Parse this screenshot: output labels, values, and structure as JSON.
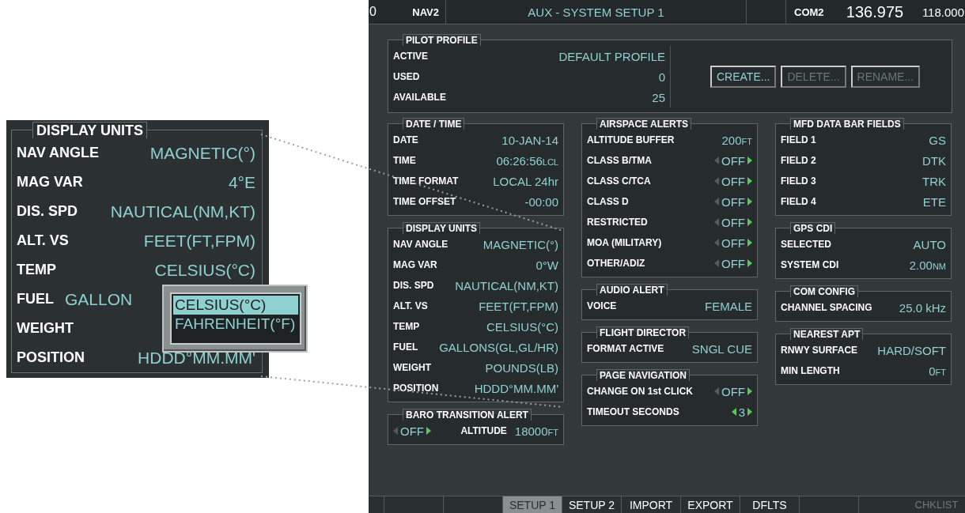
{
  "inset": {
    "title": "DISPLAY UNITS",
    "rows": [
      {
        "label": "NAV ANGLE",
        "value": "MAGNETIC(°)",
        "kind": "text"
      },
      {
        "label": "MAG VAR",
        "value": "4°E",
        "kind": "text"
      },
      {
        "label": "DIS. SPD",
        "value": "NAUTICAL(NM,KT)",
        "kind": "text"
      },
      {
        "label": "ALT. VS",
        "value": "FEET(FT,FPM)",
        "kind": "text"
      },
      {
        "label": "TEMP",
        "value": "CELSIUS(°C)",
        "kind": "text"
      },
      {
        "label": "FUEL",
        "value": "GALLON",
        "kind": "covered"
      },
      {
        "label": "WEIGHT",
        "kind": "label"
      },
      {
        "label": "POSITION",
        "value": "HDDD°MM.MM'",
        "kind": "text"
      }
    ],
    "popup": [
      {
        "label": "CELSIUS(°C)",
        "selected": true
      },
      {
        "label": "FAHRENHEIT(°F)",
        "selected": false
      }
    ]
  },
  "header": {
    "left_cut": "0",
    "nav_label": "NAV2",
    "title": "AUX - SYSTEM SETUP 1",
    "com_label": "COM2",
    "com_active": "136.975",
    "com_standby": "118.000"
  },
  "pilot_profile": {
    "title": "PILOT PROFILE",
    "rows": [
      {
        "label": "ACTIVE",
        "value": "DEFAULT PROFILE"
      },
      {
        "label": "USED",
        "value": "0"
      },
      {
        "label": "AVAILABLE",
        "value": "25"
      }
    ],
    "buttons": [
      {
        "label": "CREATE...",
        "disabled": false
      },
      {
        "label": "DELETE...",
        "disabled": true
      },
      {
        "label": "RENAME...",
        "disabled": true
      }
    ]
  },
  "columns": [
    [
      {
        "title": "DATE / TIME",
        "rows": [
          {
            "kind": "text",
            "label": "DATE",
            "value": "10-JAN-14"
          },
          {
            "kind": "text",
            "label": "TIME",
            "value": "06:26:56",
            "unit": "LCL"
          },
          {
            "kind": "text",
            "label": "TIME FORMAT",
            "value": "LOCAL 24hr"
          },
          {
            "kind": "text",
            "label": "TIME OFFSET",
            "value": "-00:00"
          }
        ]
      },
      {
        "title": "DISPLAY UNITS",
        "rows": [
          {
            "kind": "text",
            "label": "NAV ANGLE",
            "value": "MAGNETIC(°)"
          },
          {
            "kind": "text",
            "label": "MAG VAR",
            "value": "0°W"
          },
          {
            "kind": "text",
            "label": "DIS. SPD",
            "value": "NAUTICAL(NM,KT)"
          },
          {
            "kind": "text",
            "label": "ALT. VS",
            "value": "FEET(FT,FPM)"
          },
          {
            "kind": "text",
            "label": "TEMP",
            "value": "CELSIUS(°C)"
          },
          {
            "kind": "text",
            "label": "FUEL",
            "value": "GALLONS(GL,GL/HR)"
          },
          {
            "kind": "text",
            "label": "WEIGHT",
            "value": "POUNDS(LB)"
          },
          {
            "kind": "text",
            "label": "POSITION",
            "value": "HDDD°MM.MM'"
          }
        ]
      },
      {
        "title": "BARO TRANSITION ALERT",
        "rows": [
          {
            "kind": "toggle_first",
            "toggle": {
              "value": "OFF",
              "left_active": false,
              "right_active": true
            },
            "label": "ALTITUDE",
            "value": "18000",
            "unit": "FT"
          }
        ]
      }
    ],
    [
      {
        "title": "AIRSPACE ALERTS",
        "rows": [
          {
            "kind": "text",
            "label": "ALTITUDE BUFFER",
            "value": "200",
            "unit": "FT"
          },
          {
            "kind": "selector",
            "label": "CLASS B/TMA",
            "toggle": {
              "value": "OFF",
              "left_active": false,
              "right_active": true
            }
          },
          {
            "kind": "selector",
            "label": "CLASS C/TCA",
            "toggle": {
              "value": "OFF",
              "left_active": false,
              "right_active": true
            }
          },
          {
            "kind": "selector",
            "label": "CLASS D",
            "toggle": {
              "value": "OFF",
              "left_active": false,
              "right_active": true
            }
          },
          {
            "kind": "selector",
            "label": "RESTRICTED",
            "toggle": {
              "value": "OFF",
              "left_active": false,
              "right_active": true
            }
          },
          {
            "kind": "selector",
            "label": "MOA (MILITARY)",
            "toggle": {
              "value": "OFF",
              "left_active": false,
              "right_active": true
            }
          },
          {
            "kind": "selector",
            "label": "OTHER/ADIZ",
            "toggle": {
              "value": "OFF",
              "left_active": false,
              "right_active": true
            }
          }
        ]
      },
      {
        "title": "AUDIO ALERT",
        "rows": [
          {
            "kind": "text",
            "label": "VOICE",
            "value": "FEMALE"
          }
        ]
      },
      {
        "title": "FLIGHT DIRECTOR",
        "rows": [
          {
            "kind": "text",
            "label": "FORMAT ACTIVE",
            "value": "SNGL CUE"
          }
        ]
      },
      {
        "title": "PAGE NAVIGATION",
        "rows": [
          {
            "kind": "selector",
            "label": "CHANGE ON 1st CLICK",
            "toggle": {
              "value": "OFF",
              "left_active": false,
              "right_active": true
            }
          },
          {
            "kind": "selector",
            "label": "TIMEOUT SECONDS",
            "toggle": {
              "value": "3",
              "left_active": true,
              "right_active": true
            }
          }
        ]
      }
    ],
    [
      {
        "title": "MFD DATA BAR FIELDS",
        "rows": [
          {
            "kind": "text",
            "label": "FIELD 1",
            "value": "GS"
          },
          {
            "kind": "text",
            "label": "FIELD 2",
            "value": "DTK"
          },
          {
            "kind": "text",
            "label": "FIELD 3",
            "value": "TRK"
          },
          {
            "kind": "text",
            "label": "FIELD 4",
            "value": "ETE"
          }
        ]
      },
      {
        "title": "GPS CDI",
        "rows": [
          {
            "kind": "text",
            "label": "SELECTED",
            "value": "AUTO"
          },
          {
            "kind": "text",
            "label": "SYSTEM CDI",
            "value": "2.00",
            "unit": "NM"
          }
        ]
      },
      {
        "title": "COM CONFIG",
        "rows": [
          {
            "kind": "text",
            "label": "CHANNEL SPACING",
            "value": "25.0 kHz"
          }
        ]
      },
      {
        "title": "NEAREST APT",
        "rows": [
          {
            "kind": "text",
            "label": "RNWY SURFACE",
            "value": "HARD/SOFT"
          },
          {
            "kind": "text",
            "label": "MIN LENGTH",
            "value": "0",
            "unit": "FT"
          }
        ]
      }
    ]
  ],
  "softkeys": [
    {
      "selected": false,
      "disabled": false
    },
    {
      "selected": false,
      "disabled": false
    },
    {
      "selected": false,
      "disabled": false
    },
    {
      "label": "SETUP 1",
      "selected": true,
      "disabled": false
    },
    {
      "label": "SETUP 2",
      "selected": false,
      "disabled": false
    },
    {
      "label": "IMPORT",
      "selected": false,
      "disabled": false
    },
    {
      "label": "EXPORT",
      "selected": false,
      "disabled": false
    },
    {
      "label": "DFLTS",
      "selected": false,
      "disabled": false
    },
    {
      "selected": false,
      "disabled": false
    },
    {
      "label": "CHKLIST",
      "selected": false,
      "disabled": true
    }
  ]
}
